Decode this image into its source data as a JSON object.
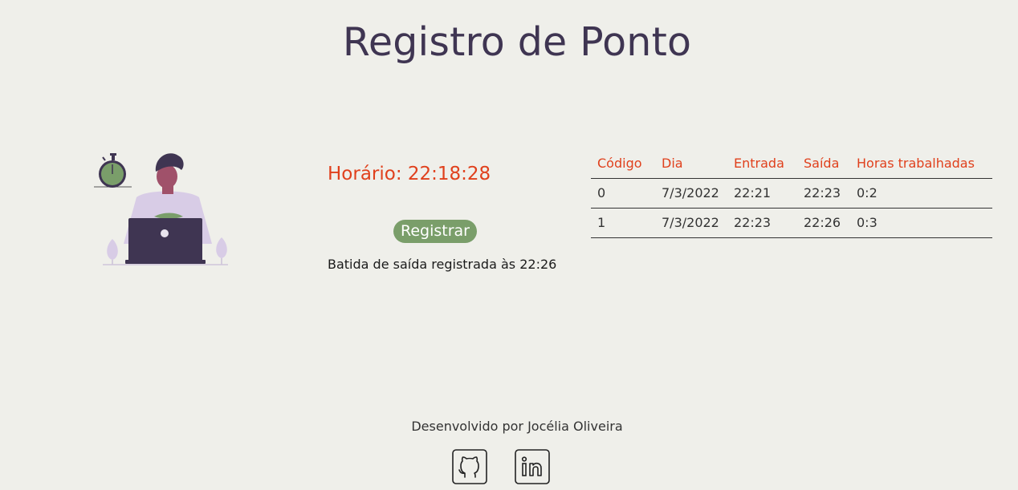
{
  "header": {
    "title": "Registro de Ponto"
  },
  "clock": {
    "label": "Horário: 22:18:28"
  },
  "actions": {
    "register_label": "Registrar"
  },
  "status": {
    "message": "Batida de saída registrada às 22:26"
  },
  "records": {
    "columns": [
      "Código",
      "Dia",
      "Entrada",
      "Saída",
      "Horas trabalhadas"
    ],
    "rows": [
      [
        "0",
        "7/3/2022",
        "22:21",
        "22:23",
        "0:2"
      ],
      [
        "1",
        "7/3/2022",
        "22:23",
        "22:26",
        "0:3"
      ]
    ]
  },
  "footer": {
    "credit": "Desenvolvido por Jocélia Oliveira",
    "links": [
      {
        "icon": "github-icon"
      },
      {
        "icon": "linkedin-icon"
      }
    ]
  },
  "colors": {
    "background": "#efefea",
    "title": "#3f3552",
    "accent": "#e0401c",
    "button": "#7a9e6a",
    "illustration_purple": "#3f3552",
    "illustration_lilac": "#d8cce6",
    "illustration_skin": "#a0516a"
  }
}
